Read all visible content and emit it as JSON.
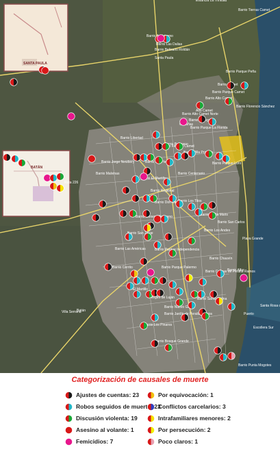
{
  "map": {
    "labels": [
      "Barrio Parque Peña",
      "Barrio Camet",
      "Barrio Parque Camet",
      "Barrio Alto Camet",
      "Alto Camet",
      "Barrio Florencio Sánchez",
      "Barrio Zacagnini",
      "Barrio Parque La Florida",
      "Cabañas",
      "Barrio Libertad",
      "Barrio Belgrano",
      "Barrio Villa Primera",
      "Barrio Parque Luro",
      "Barrio Jorge Newbery",
      "Barrio Malvinas",
      "Barrio Las Heras",
      "Barrio Centenario",
      "Barrio Los Tilos",
      "Barrio San Carlos",
      "Barrio El Martillo",
      "Barrio Regional",
      "Barrio Don Bosco",
      "Barrio Stella Maris",
      "Barrio Los Andes",
      "Barrio Chauvín",
      "Barrio Colinas de Peralta Ramos",
      "Barrio Alfar",
      "Barrio Santa Celina",
      "Barrio Bosque Grande",
      "Barrio Los Pinares",
      "Barrio Punta Mogotes",
      "Virgen de Luján",
      "Barrio Cerrito",
      "Batán",
      "Estancia La Trinidad",
      "Barrio Tierras Camet",
      "Barrio Autódromo",
      "Barrio Las Dalias",
      "Barrio Belisario Roldán",
      "Santa Paula",
      "Barrio Félix U. Camet",
      "Barrio Las Américas",
      "Puerto",
      "Barrio Parque Palermo",
      "Villa Serrana",
      "Barrio Alto Camet Norte",
      "Barrio San Jorge",
      "Santa Rosa del Mar",
      "Playa Grande",
      "Escollera Sur",
      "Barrio General Belgrano",
      "Ruta 226",
      "Barrio Nuevo Golf",
      "Barrio Jardín de Peralta Ramos",
      "Barrio Parque Independencia",
      "El Martillo"
    ],
    "inset_top_label": "SANTA PAULA",
    "inset_bottom_label": "BATÁN"
  },
  "legend": {
    "title": "Categorización de causales de muerte",
    "items": [
      {
        "label": "Ajustes de cuentas: 23",
        "colors": [
          "#d81818",
          "#1a1a1a"
        ]
      },
      {
        "label": "Robos seguidos de muerte: 23",
        "colors": [
          "#d81818",
          "#20b8c8"
        ]
      },
      {
        "label": "Discusión violenta: 19",
        "colors": [
          "#d81818",
          "#1aa838"
        ]
      },
      {
        "label": "Asesino al volante: 1",
        "colors": [
          "#d81818",
          "#d81818"
        ]
      },
      {
        "label": "Femicidios: 7",
        "colors": [
          "#e8168c",
          "#e8168c"
        ]
      },
      {
        "label": "Por equivocación: 1",
        "colors": [
          "#d81818",
          "#f0c010"
        ]
      },
      {
        "label": "Conflictos carcelarios: 3",
        "colors": [
          "#d81818",
          "#3040c0"
        ]
      },
      {
        "label": "Intrafamiliares menores: 2",
        "colors": [
          "#d81818",
          "#f5e100"
        ]
      },
      {
        "label": "Por persecución: 2",
        "colors": [
          "#d81818",
          "#f0f000"
        ]
      },
      {
        "label": "Poco claros: 1",
        "colors": [
          "#d81818",
          "#e8a0b0"
        ]
      }
    ]
  }
}
